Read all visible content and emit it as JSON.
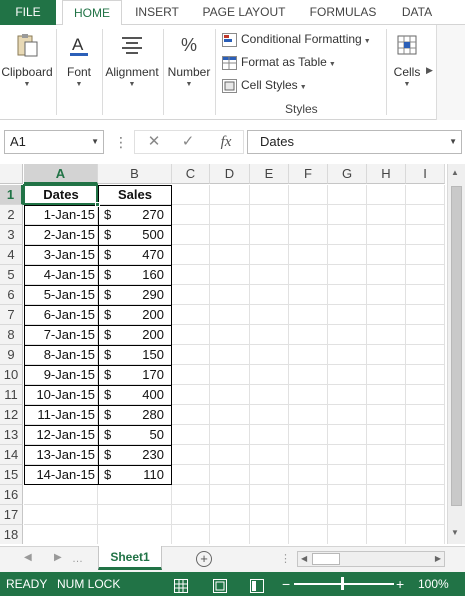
{
  "tabs": [
    {
      "label": "FILE"
    },
    {
      "label": "HOME"
    },
    {
      "label": "INSERT"
    },
    {
      "label": "PAGE LAYOUT"
    },
    {
      "label": "FORMULAS"
    },
    {
      "label": "DATA"
    }
  ],
  "ribbon": {
    "clipboard": "Clipboard",
    "font": "Font",
    "alignment": "Alignment",
    "number": "Number",
    "conditional_formatting": "Conditional Formatting",
    "format_as_table": "Format as Table",
    "cell_styles": "Cell Styles",
    "styles_group": "Styles",
    "cells": "Cells",
    "number_icon": "%"
  },
  "formula_bar": {
    "name_box": "A1",
    "fx": "fx",
    "content": "Dates"
  },
  "columns": [
    "A",
    "B",
    "C",
    "D",
    "E",
    "F",
    "G",
    "H",
    "I"
  ],
  "rows": [
    "1",
    "2",
    "3",
    "4",
    "5",
    "6",
    "7",
    "8",
    "9",
    "10",
    "11",
    "12",
    "13",
    "14",
    "15",
    "16",
    "17",
    "18"
  ],
  "table": {
    "header": [
      "Dates",
      "Sales"
    ],
    "currency": "$",
    "rows": [
      [
        "1-Jan-15",
        "270"
      ],
      [
        "2-Jan-15",
        "500"
      ],
      [
        "3-Jan-15",
        "470"
      ],
      [
        "4-Jan-15",
        "160"
      ],
      [
        "5-Jan-15",
        "290"
      ],
      [
        "6-Jan-15",
        "200"
      ],
      [
        "7-Jan-15",
        "200"
      ],
      [
        "8-Jan-15",
        "150"
      ],
      [
        "9-Jan-15",
        "170"
      ],
      [
        "10-Jan-15",
        "400"
      ],
      [
        "11-Jan-15",
        "280"
      ],
      [
        "12-Jan-15",
        "50"
      ],
      [
        "13-Jan-15",
        "230"
      ],
      [
        "14-Jan-15",
        "110"
      ]
    ]
  },
  "sheet": {
    "name": "Sheet1"
  },
  "status": {
    "ready": "READY",
    "num_lock": "NUM LOCK",
    "zoom": "100%"
  },
  "colors": {
    "accent": "#217346"
  }
}
